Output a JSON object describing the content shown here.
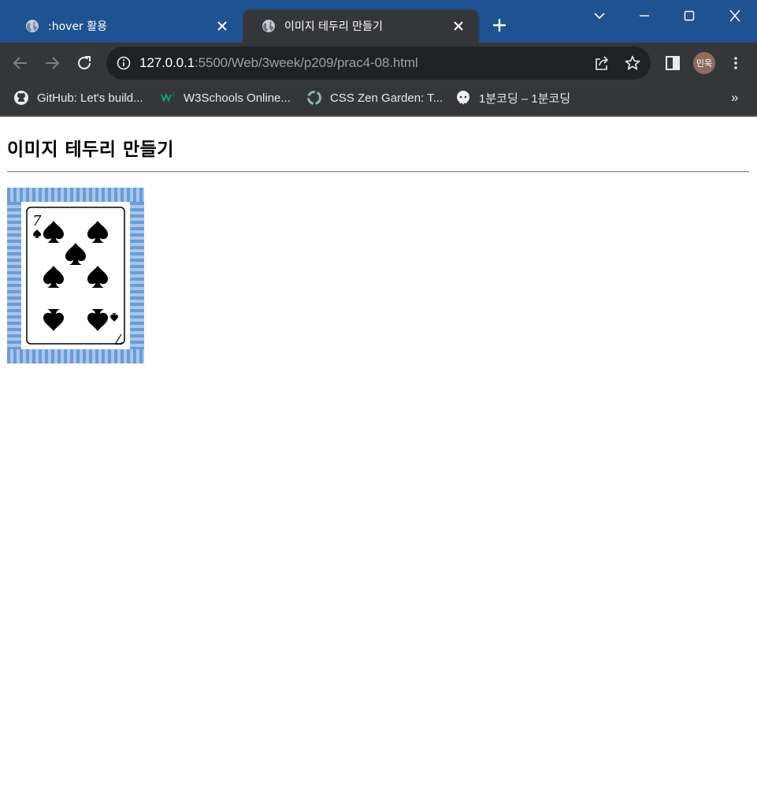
{
  "browser": {
    "tabs": [
      {
        "title": ":hover 활용",
        "active": false
      },
      {
        "title": "이미지 테두리 만들기",
        "active": true
      }
    ],
    "url": {
      "host": "127.0.0.1",
      "rest": ":5500/Web/3week/p209/prac4-08.html"
    },
    "profile_initials": "민욱",
    "bookmarks": [
      {
        "label": "GitHub: Let's build...",
        "icon": "github-icon"
      },
      {
        "label": "W3Schools Online...",
        "icon": "w3schools-icon"
      },
      {
        "label": "CSS Zen Garden: T...",
        "icon": "zen-garden-icon"
      },
      {
        "label": "1분코딩 – 1분코딩",
        "icon": "onemin-coding-icon"
      }
    ],
    "bookmarks_overflow": "»"
  },
  "page": {
    "heading": "이미지 테두리 만들기",
    "image": {
      "description_icon": "seven-of-spades-card",
      "rank": "7",
      "suit": "spades",
      "border_colors": [
        "#6a9cd6",
        "#a9c6ea"
      ]
    }
  },
  "colors": {
    "titlebar": "#1f5290",
    "toolbar": "#35363a",
    "omnibox": "#202124"
  }
}
